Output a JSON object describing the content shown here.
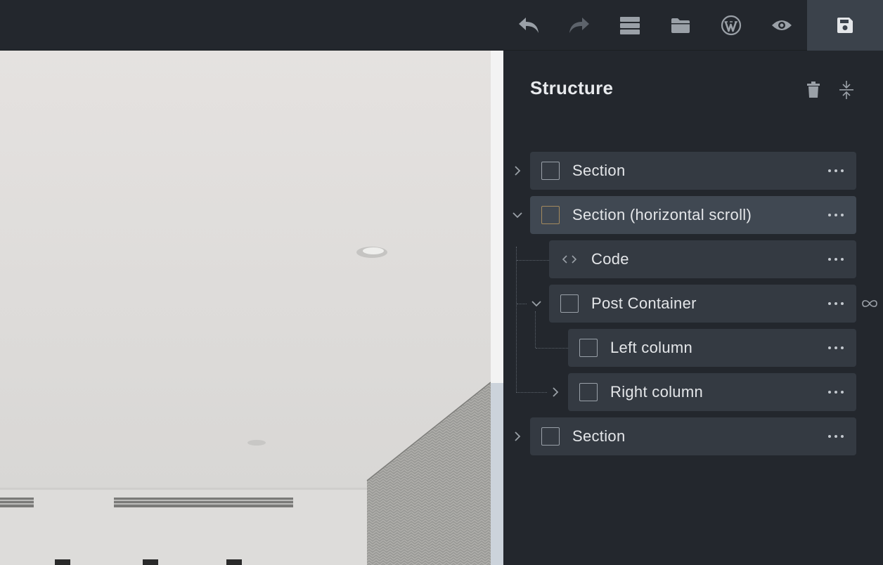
{
  "toolbar": {
    "buttons": [
      {
        "name": "undo-button",
        "icon": "undo-icon"
      },
      {
        "name": "redo-button",
        "icon": "redo-icon"
      },
      {
        "name": "structure-button",
        "icon": "layers-icon"
      },
      {
        "name": "templates-button",
        "icon": "folder-icon"
      },
      {
        "name": "wordpress-button",
        "icon": "wordpress-icon"
      },
      {
        "name": "preview-button",
        "icon": "eye-icon"
      },
      {
        "name": "save-button",
        "icon": "save-icon"
      }
    ]
  },
  "panel": {
    "title": "Structure",
    "actions": [
      {
        "name": "delete-all-button",
        "icon": "trash-icon"
      },
      {
        "name": "collapse-all-button",
        "icon": "collapse-icon"
      }
    ],
    "items": [
      {
        "label": "Section",
        "level": 0,
        "expanded": false,
        "has_children": true,
        "active": false,
        "icon": "checkbox"
      },
      {
        "label": "Section (horizontal scroll)",
        "level": 0,
        "expanded": true,
        "has_children": true,
        "active": true,
        "icon": "checkbox"
      },
      {
        "label": "Code",
        "level": 1,
        "expanded": false,
        "has_children": false,
        "active": false,
        "icon": "code-icon"
      },
      {
        "label": "Post Container",
        "level": 1,
        "expanded": true,
        "has_children": true,
        "active": false,
        "icon": "checkbox",
        "loop": true
      },
      {
        "label": "Left column",
        "level": 2,
        "expanded": false,
        "has_children": false,
        "active": false,
        "icon": "checkbox"
      },
      {
        "label": "Right column",
        "level": 2,
        "expanded": false,
        "has_children": true,
        "active": false,
        "icon": "checkbox"
      },
      {
        "label": "Section",
        "level": 0,
        "expanded": false,
        "has_children": true,
        "active": false,
        "icon": "checkbox"
      }
    ]
  },
  "colors": {
    "bg": "#23272d",
    "row": "#343a42",
    "row_active": "#404852",
    "active_checkbox": "#a48a5e"
  }
}
